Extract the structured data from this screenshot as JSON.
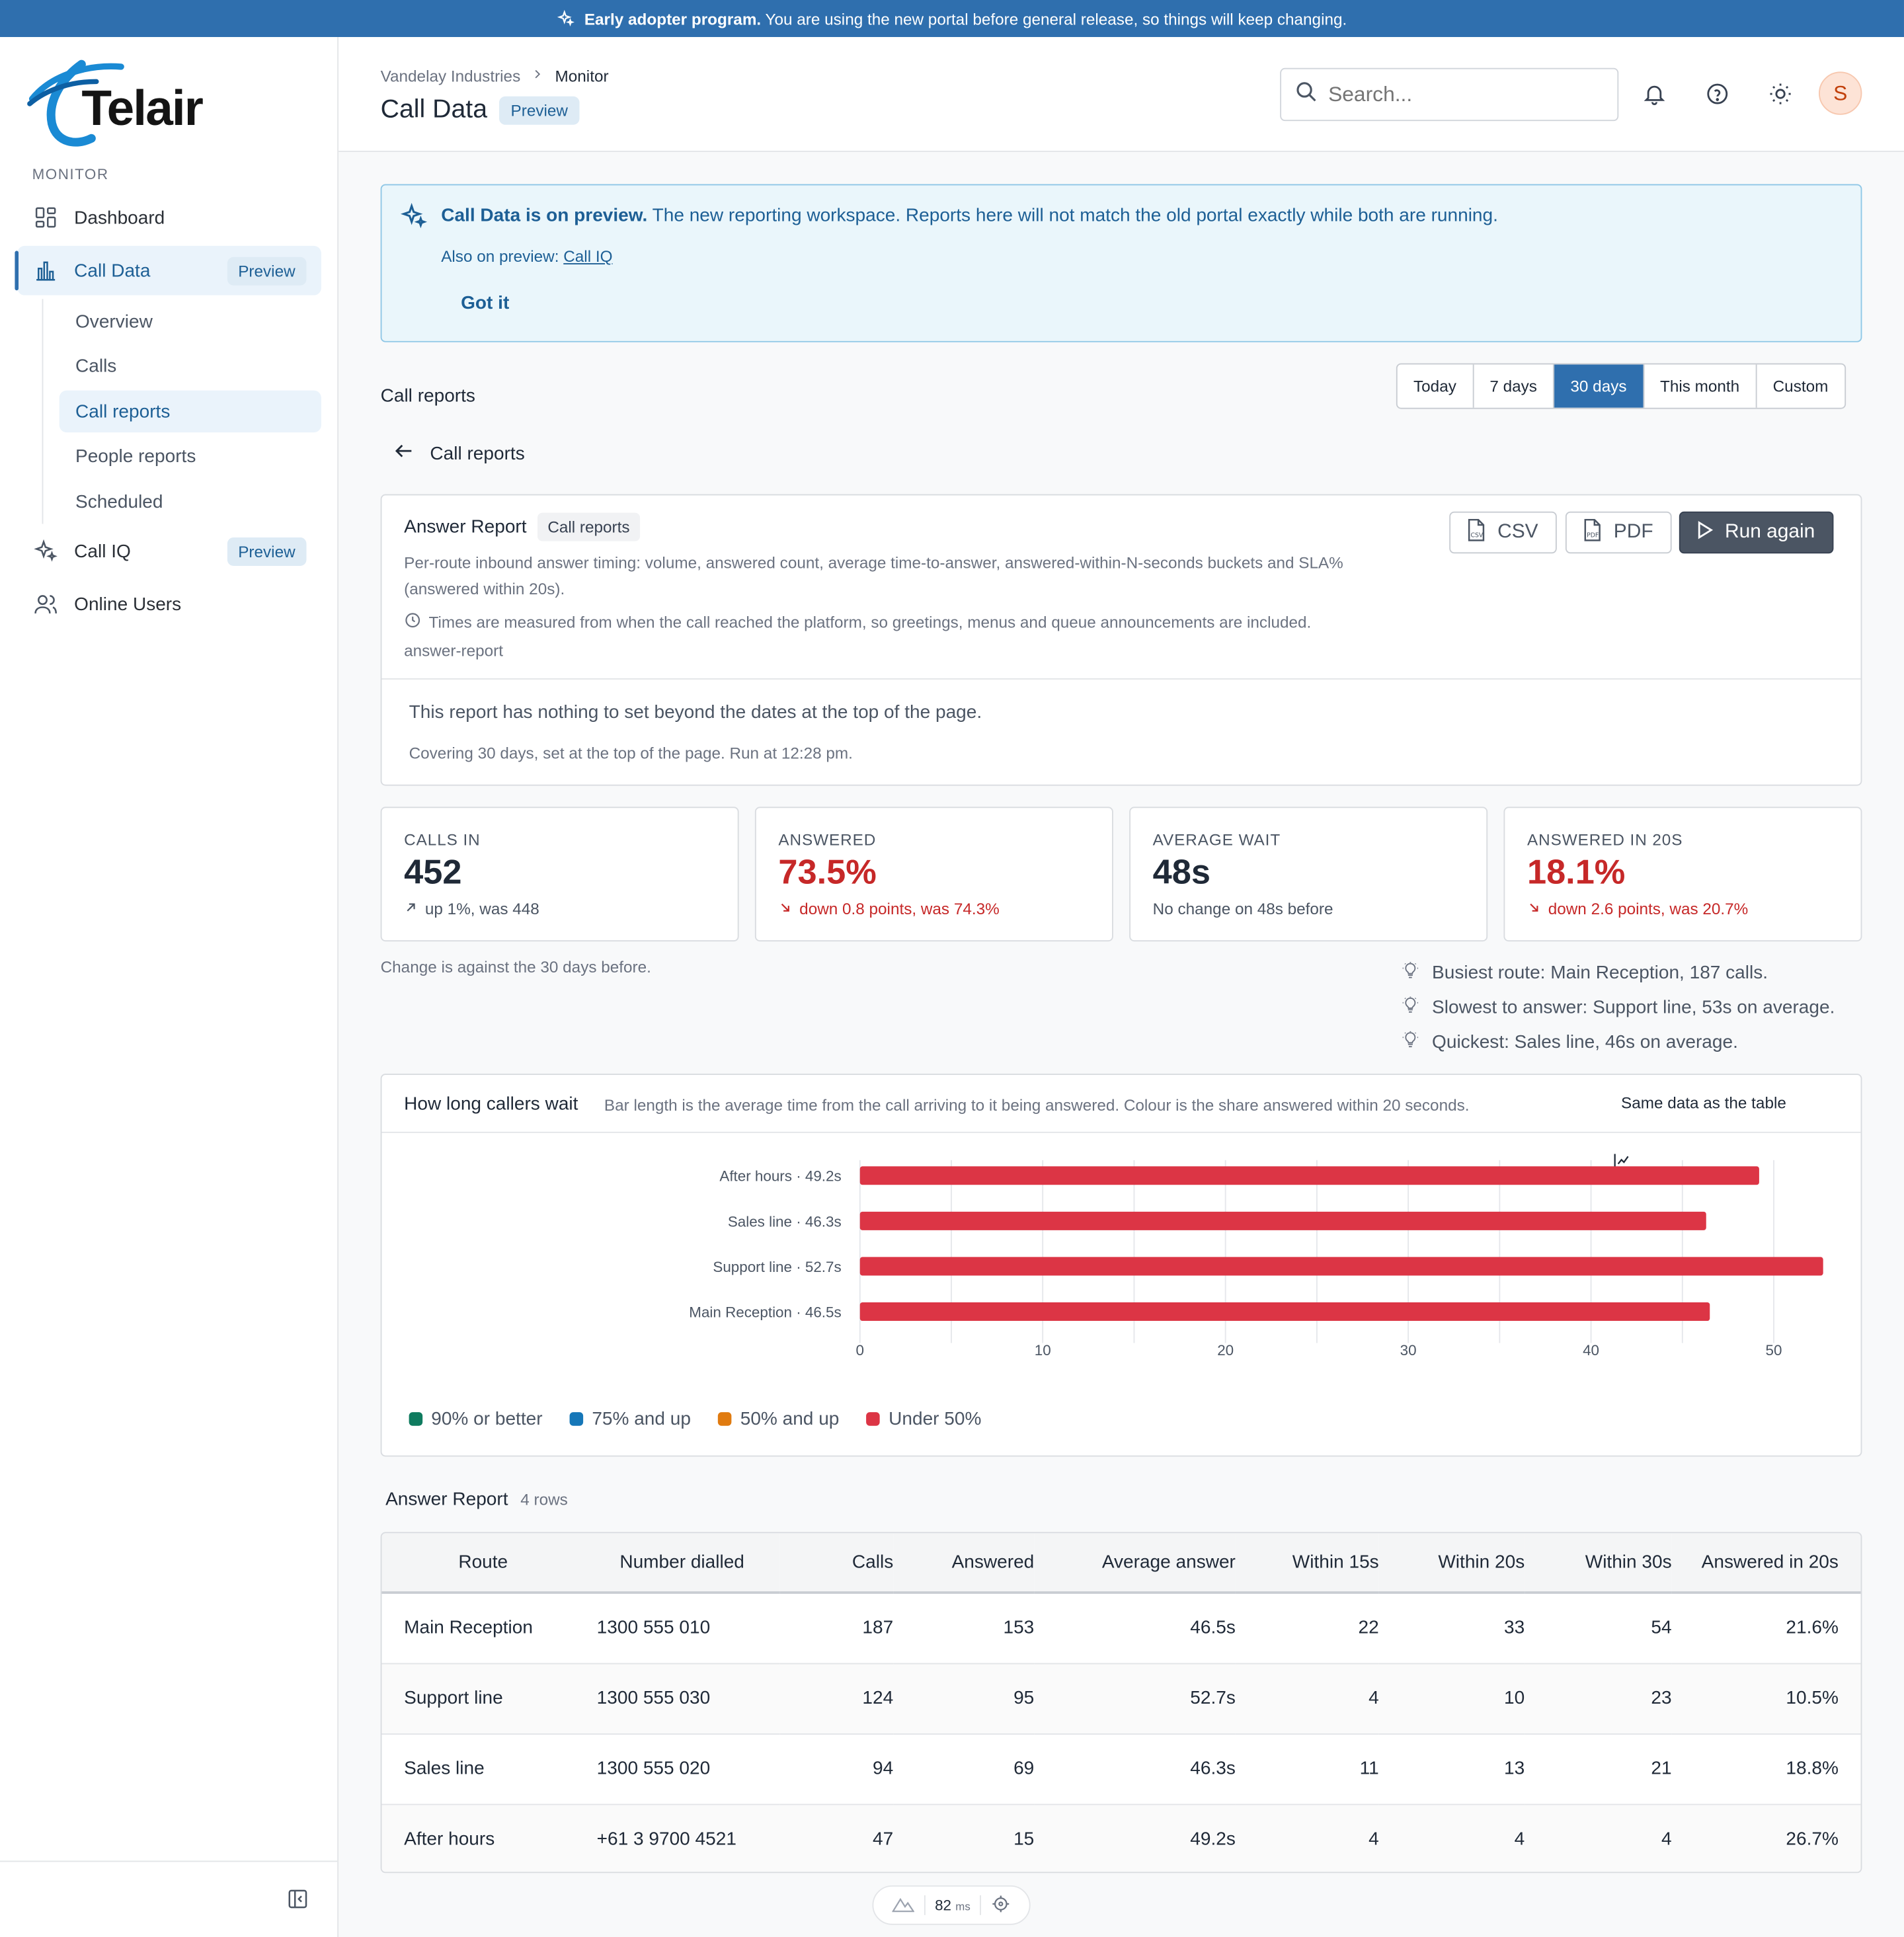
{
  "banner": {
    "strong": "Early adopter program.",
    "text": "You are using the new portal before general release, so things will keep changing."
  },
  "brand": {
    "name": "Telair",
    "accent": "#1a8ad4"
  },
  "sidebar": {
    "section": "MONITOR",
    "items": [
      {
        "label": "Dashboard",
        "icon": "dashboard-icon"
      },
      {
        "label": "Call Data",
        "icon": "bar-chart-icon",
        "badge": "Preview"
      },
      {
        "label": "Call IQ",
        "icon": "sparkles-icon",
        "badge": "Preview"
      },
      {
        "label": "Online Users",
        "icon": "users-icon"
      }
    ],
    "sub_items": [
      "Overview",
      "Calls",
      "Call reports",
      "People reports",
      "Scheduled"
    ]
  },
  "header": {
    "breadcrumb": [
      "Vandelay Industries",
      "Monitor"
    ],
    "title": "Call Data",
    "badge": "Preview",
    "search_placeholder": "Search...",
    "avatar": "S"
  },
  "notice": {
    "strong": "Call Data is on preview.",
    "text": "The new reporting workspace. Reports here will not match the old portal exactly while both are running.",
    "also_label": "Also on preview:",
    "also_link": "Call IQ",
    "dismiss": "Got it"
  },
  "reports": {
    "section_title": "Call reports",
    "ranges": [
      "Today",
      "7 days",
      "30 days",
      "This month",
      "Custom"
    ],
    "active_range": "30 days",
    "back_label": "Call reports"
  },
  "report": {
    "title": "Answer Report",
    "tag": "Call reports",
    "description": "Per-route inbound answer timing: volume, answered count, average time-to-answer, answered-within-N-seconds buckets and SLA% (answered within 20s).",
    "note": "Times are measured from when the call reached the platform, so greetings, menus and queue announcements are included.",
    "slug": "answer-report",
    "empty": "This report has nothing to set beyond the dates at the top of the page.",
    "covering": "Covering 30 days, set at the top of the page. Run at 12:28 pm.",
    "buttons": {
      "csv": "CSV",
      "pdf": "PDF",
      "run": "Run again"
    }
  },
  "kpis": [
    {
      "label": "CALLS IN",
      "value": "452",
      "change": "up 1%, was 448",
      "trend": "up",
      "bad": false
    },
    {
      "label": "ANSWERED",
      "value": "73.5%",
      "change": "down 0.8 points, was 74.3%",
      "trend": "down",
      "bad": true
    },
    {
      "label": "AVERAGE WAIT",
      "value": "48s",
      "change": "No change on 48s before",
      "trend": "none",
      "bad": false
    },
    {
      "label": "ANSWERED IN 20S",
      "value": "18.1%",
      "change": "down 2.6 points, was 20.7%",
      "trend": "down",
      "bad": true
    }
  ],
  "kpi_note": "Change is against the 30 days before.",
  "insights": [
    "Busiest route: Main Reception, 187 calls.",
    "Slowest to answer: Support line, 53s on average.",
    "Quickest: Sales line, 46s on average."
  ],
  "chart": {
    "title": "How long callers wait",
    "subtitle": "Bar length is the average time from the call arriving to it being answered. Colour is the share answered within 20 seconds.",
    "same_data": "Same data as the table",
    "legend": [
      {
        "label": "90% or better",
        "color": "#0f7b5f"
      },
      {
        "label": "75% and up",
        "color": "#1677b8"
      },
      {
        "label": "50% and up",
        "color": "#e07b10"
      },
      {
        "label": "Under 50%",
        "color": "#dc3545"
      }
    ]
  },
  "chart_data": {
    "type": "bar",
    "orientation": "horizontal",
    "categories": [
      "After hours · 49.2s",
      "Sales line · 46.3s",
      "Support line · 52.7s",
      "Main Reception · 46.5s"
    ],
    "values": [
      49.2,
      46.3,
      52.7,
      46.5
    ],
    "bar_color": "#dc3545",
    "xlim": [
      0,
      53
    ],
    "xticks": [
      0,
      10,
      20,
      30,
      40,
      50
    ],
    "grid": true
  },
  "table": {
    "title": "Answer Report",
    "row_count": "4 rows",
    "columns": [
      "Route",
      "Number dialled",
      "Calls",
      "Answered",
      "Average answer",
      "Within 15s",
      "Within 20s",
      "Within 30s",
      "Answered in 20s"
    ],
    "rows": [
      [
        "Main Reception",
        "1300 555 010",
        "187",
        "153",
        "46.5s",
        "22",
        "33",
        "54",
        "21.6%"
      ],
      [
        "Support line",
        "1300 555 030",
        "124",
        "95",
        "52.7s",
        "4",
        "10",
        "23",
        "10.5%"
      ],
      [
        "Sales line",
        "1300 555 020",
        "94",
        "69",
        "46.3s",
        "11",
        "13",
        "21",
        "18.8%"
      ],
      [
        "After hours",
        "+61 3 9700 4521",
        "47",
        "15",
        "49.2s",
        "4",
        "4",
        "4",
        "26.7%"
      ]
    ]
  },
  "perf": {
    "value": "82",
    "unit": "ms"
  }
}
